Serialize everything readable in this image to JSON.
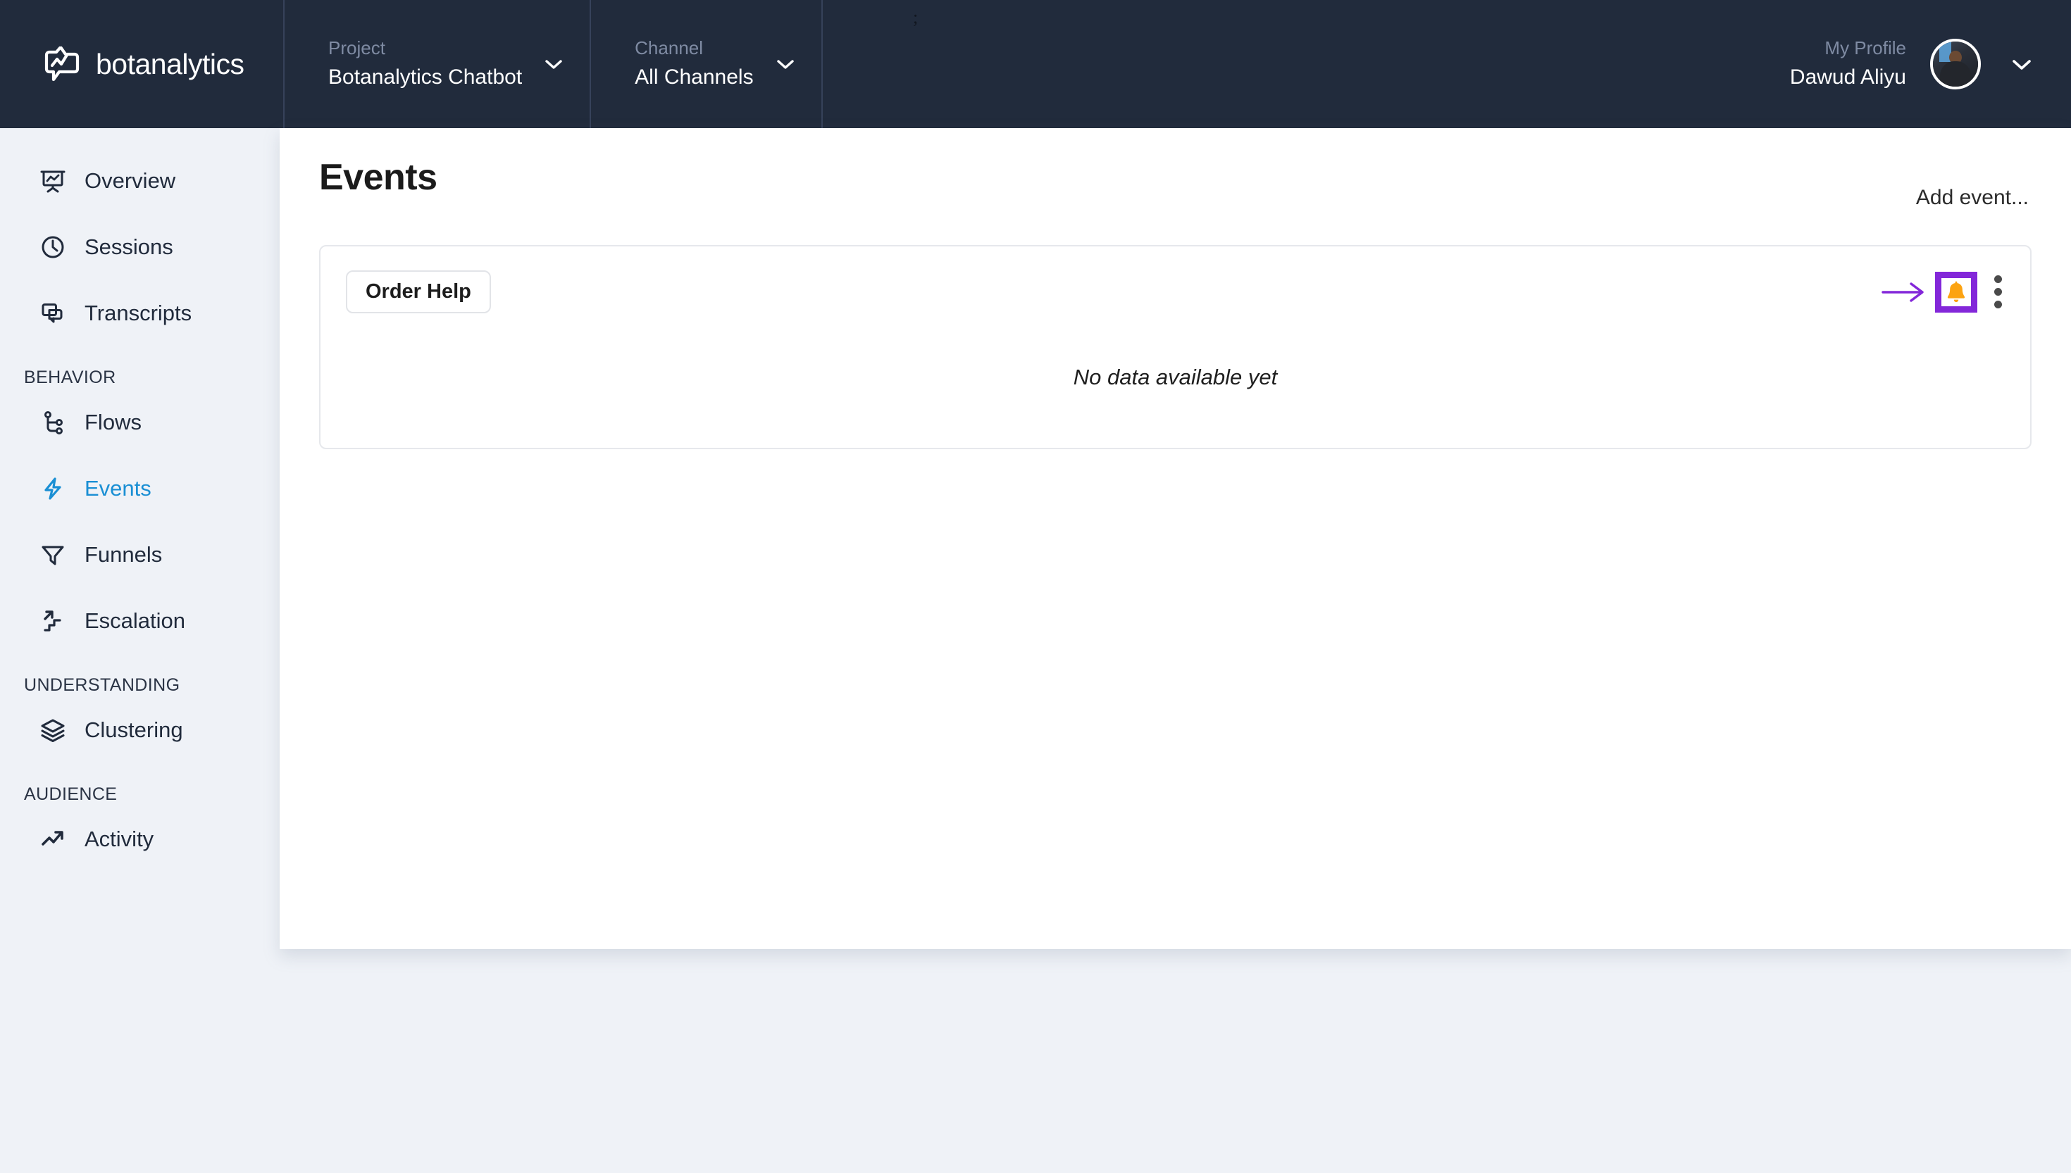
{
  "brand": {
    "name": "botanalytics",
    "logo_icon": "speech-bubble-chart-icon"
  },
  "header": {
    "project": {
      "label": "Project",
      "value": "Botanalytics Chatbot",
      "caret_icon": "chevron-down-icon"
    },
    "channel": {
      "label": "Channel",
      "value": "All Channels",
      "caret_icon": "chevron-down-icon"
    },
    "profile": {
      "label": "My Profile",
      "value": "Dawud Aliyu",
      "avatar_icon": "user-avatar-photo",
      "caret_icon": "chevron-down-icon"
    },
    "tiny_mark": ";"
  },
  "sidebar": {
    "top_items": [
      {
        "label": "Overview",
        "icon": "presentation-chart-icon",
        "active": false
      },
      {
        "label": "Sessions",
        "icon": "clock-icon",
        "active": false
      },
      {
        "label": "Transcripts",
        "icon": "chat-bubbles-icon",
        "active": false
      }
    ],
    "sections": [
      {
        "title": "BEHAVIOR",
        "items": [
          {
            "label": "Flows",
            "icon": "flow-branch-icon",
            "active": false
          },
          {
            "label": "Events",
            "icon": "lightning-bolt-icon",
            "active": true
          },
          {
            "label": "Funnels",
            "icon": "funnel-icon",
            "active": false
          },
          {
            "label": "Escalation",
            "icon": "escalation-stairs-arrow-icon",
            "active": false
          }
        ]
      },
      {
        "title": "UNDERSTANDING",
        "items": [
          {
            "label": "Clustering",
            "icon": "layers-icon",
            "active": false
          }
        ]
      },
      {
        "title": "AUDIENCE",
        "items": [
          {
            "label": "Activity",
            "icon": "trending-up-arrow-icon",
            "active": false
          }
        ]
      }
    ]
  },
  "main": {
    "title": "Events",
    "add_event_label": "Add event...",
    "card": {
      "tag_label": "Order Help",
      "arrow_icon": "long-right-arrow-icon",
      "bell_icon": "bell-icon",
      "kebab_icon": "vertical-ellipsis-icon",
      "empty_text": "No data available yet"
    }
  },
  "colors": {
    "header_bg": "#212b3c",
    "sidebar_bg": "#eff2f7",
    "panel_bg": "#ffffff",
    "accent_active": "#1a8fd4",
    "highlight_purple": "#8327d9",
    "bell_orange": "#fca311"
  }
}
